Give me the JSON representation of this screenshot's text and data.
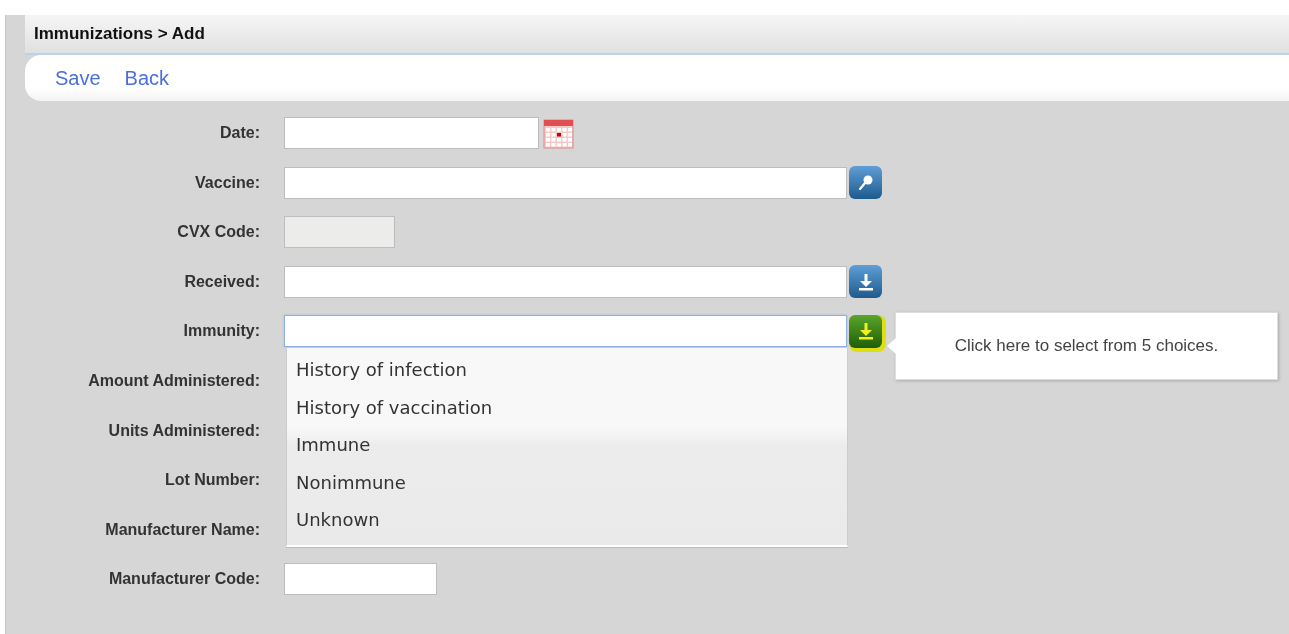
{
  "breadcrumb": "Immunizations > Add",
  "toolbar": [
    {
      "label": "Save"
    },
    {
      "label": "Back"
    }
  ],
  "fields": [
    {
      "label": "Date:",
      "kind": "date",
      "disabled": false,
      "focused": false
    },
    {
      "label": "Vaccine:",
      "kind": "lookup",
      "disabled": false,
      "focused": false
    },
    {
      "label": "CVX Code:",
      "kind": "short",
      "disabled": true,
      "focused": false
    },
    {
      "label": "Received:",
      "kind": "select",
      "disabled": false,
      "focused": false
    },
    {
      "label": "Immunity:",
      "kind": "select",
      "disabled": false,
      "focused": true
    },
    {
      "label": "Amount Administered:",
      "kind": "covered"
    },
    {
      "label": "Units Administered:",
      "kind": "covered"
    },
    {
      "label": "Lot Number:",
      "kind": "covered"
    },
    {
      "label": "Manufacturer Name:",
      "kind": "covered"
    },
    {
      "label": "Manufacturer Code:",
      "kind": "code",
      "disabled": false,
      "focused": false
    }
  ],
  "dropdown": {
    "options": [
      "History of infection",
      "History of vaccination",
      "Immune",
      "Nonimmune",
      "Unknown"
    ]
  },
  "tooltip": "Click here to select from 5 choices."
}
